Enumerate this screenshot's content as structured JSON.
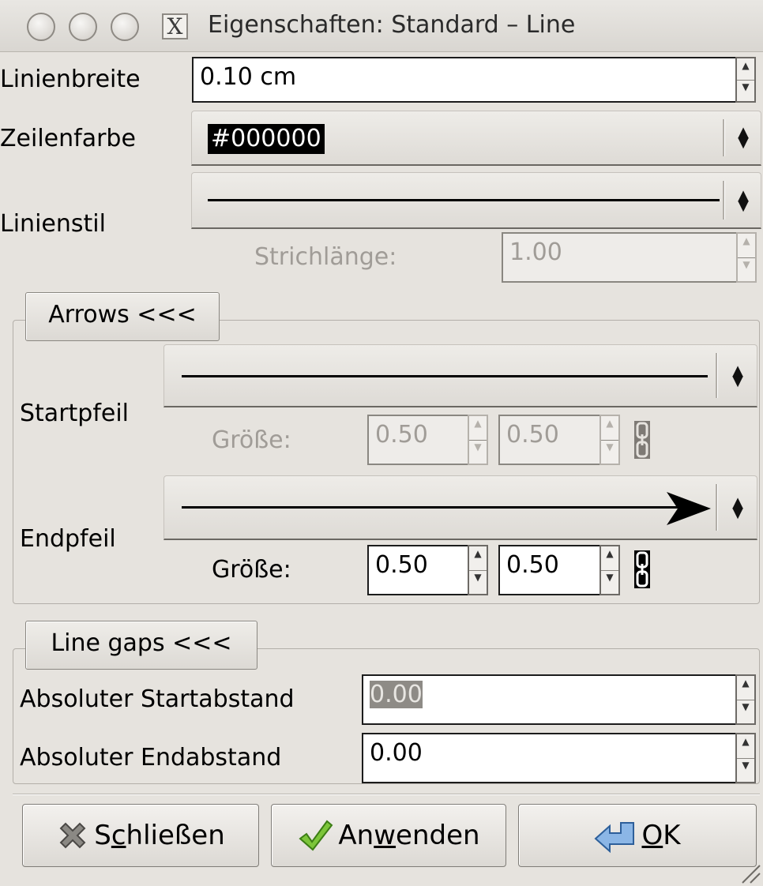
{
  "window": {
    "title": "Eigenschaften: Standard – Line"
  },
  "line_width": {
    "label": "Linienbreite",
    "value": "0.10 cm"
  },
  "line_color": {
    "label": "Zeilenfarbe",
    "value": "#000000",
    "swatch_color": "#000000"
  },
  "line_style": {
    "label": "Linienstil",
    "dash_label": "Strichlänge:",
    "dash_value": "1.00"
  },
  "arrows": {
    "toggle_label": "Arrows <<<",
    "start_label": "Startpfeil",
    "start_size_label": "Größe:",
    "start_width": "0.50",
    "start_height": "0.50",
    "end_label": "Endpfeil",
    "end_size_label": "Größe:",
    "end_width": "0.50",
    "end_height": "0.50"
  },
  "gaps": {
    "toggle_label": "Line gaps <<<",
    "start_label": "Absoluter Startabstand",
    "start_value": "0.00",
    "end_label": "Absoluter Endabstand",
    "end_value": "0.00"
  },
  "buttons": {
    "close_pre": "S",
    "close_mn": "c",
    "close_post": "hließen",
    "apply_pre": "An",
    "apply_mn": "w",
    "apply_post": "enden",
    "ok_pre": "",
    "ok_mn": "O",
    "ok_post": "K"
  },
  "icons": {
    "close": "close-x-icon",
    "apply": "checkmark-icon",
    "ok": "ok-return-arrow-icon",
    "chain": "chain-link-icon"
  }
}
